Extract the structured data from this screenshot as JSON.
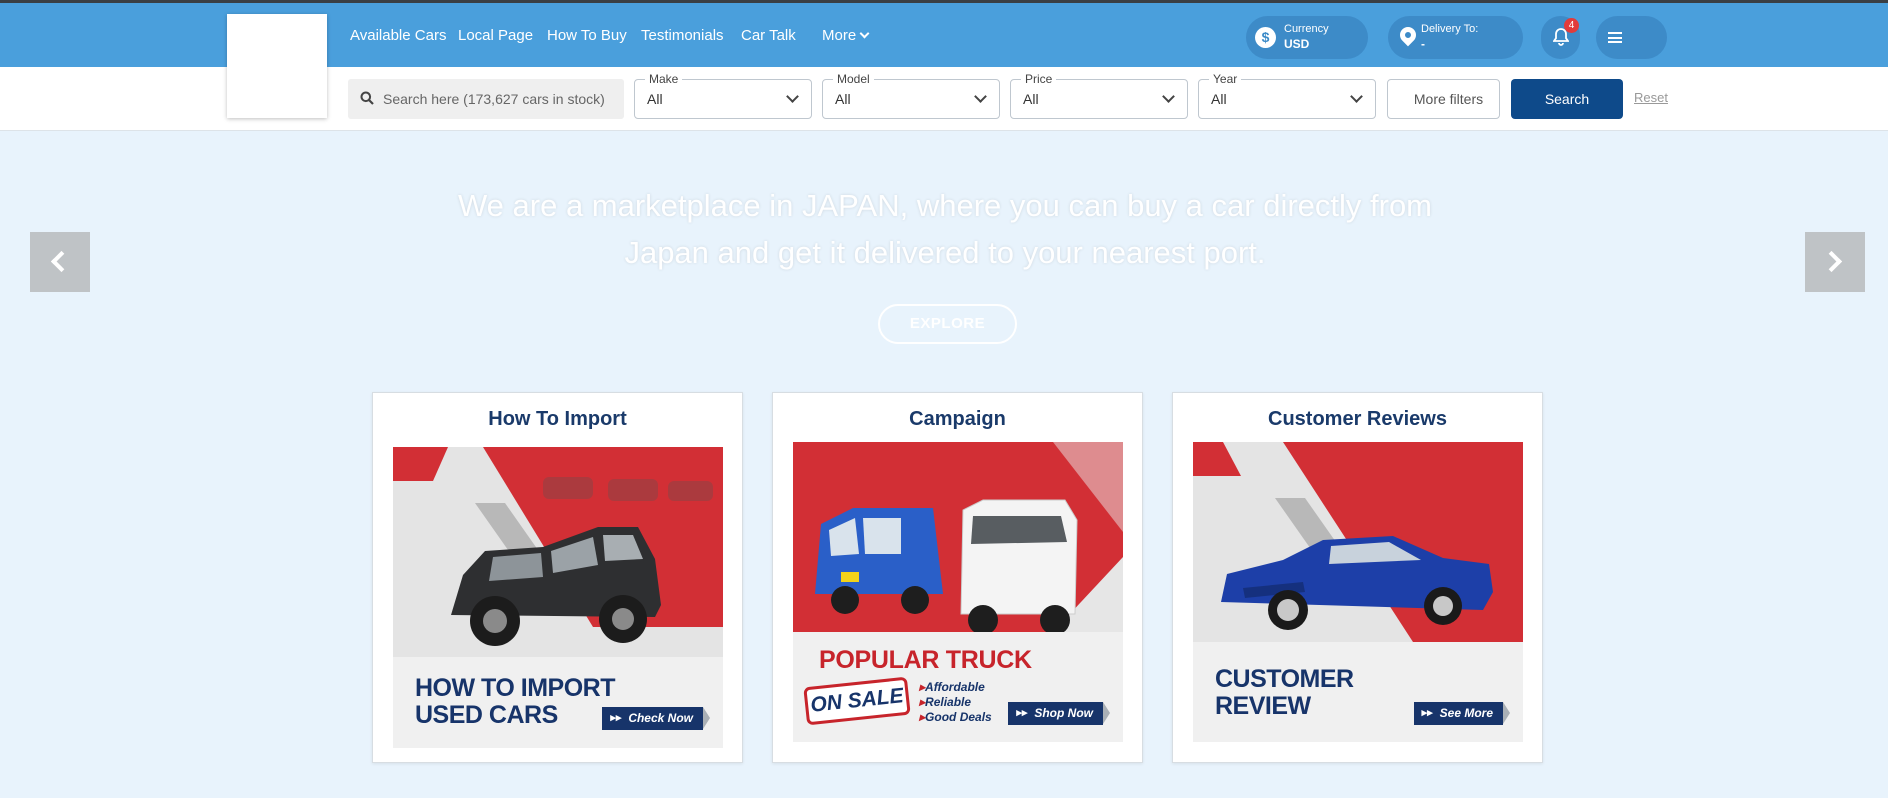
{
  "nav": {
    "links": [
      "Available Cars",
      "Local Page",
      "How To Buy",
      "Testimonials",
      "Car Talk"
    ],
    "more_label": "More",
    "currency": {
      "label": "Currency",
      "value": "USD",
      "icon": "dollar-icon"
    },
    "delivery": {
      "label": "Delivery To:",
      "value": "-",
      "icon": "location-pin-icon"
    },
    "notifications": {
      "count": "4",
      "icon": "bell-icon"
    },
    "menu_icon": "hamburger-menu-icon"
  },
  "filters": {
    "search_placeholder": "Search here (173,627 cars in stock)",
    "make": {
      "label": "Make",
      "value": "All"
    },
    "model": {
      "label": "Model",
      "value": "All"
    },
    "price": {
      "label": "Price",
      "value": "All"
    },
    "year": {
      "label": "Year",
      "value": "All"
    },
    "more_filters_label": "More filters",
    "search_label": "Search",
    "reset_label": "Reset"
  },
  "hero": {
    "text": "We are a marketplace in JAPAN, where you can buy a car directly from Japan and get it delivered to your nearest port.",
    "explore_label": "EXPLORE"
  },
  "cards": [
    {
      "title": "How To Import",
      "image_text": [
        "HOW TO IMPORT",
        "USED CARS"
      ],
      "button": "Check Now"
    },
    {
      "title": "Campaign",
      "image_text": [
        "POPULAR TRUCK"
      ],
      "tag": "ON SALE",
      "bullets": [
        "Affordable",
        "Reliable",
        "Good Deals"
      ],
      "button": "Shop Now"
    },
    {
      "title": "Customer Reviews",
      "image_text": [
        "CUSTOMER",
        "REVIEW"
      ],
      "button": "See More"
    }
  ],
  "colors": {
    "navbar": "#4a9fdc",
    "accent": "#0e4a8a",
    "brand_red": "#c7242b",
    "page_bg": "#e8f3fc"
  }
}
